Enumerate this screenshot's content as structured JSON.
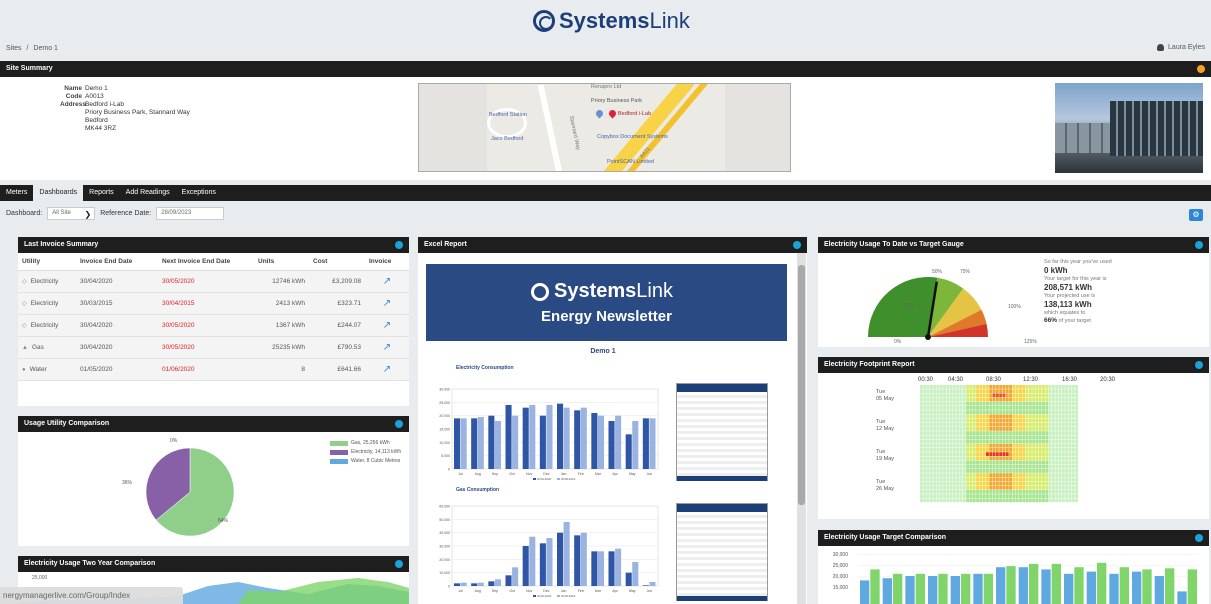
{
  "brand": {
    "name_bold": "Systems",
    "name_light": "Link"
  },
  "breadcrumb": {
    "root": "Sites",
    "sep": "/",
    "current": "Demo 1"
  },
  "user": {
    "name": "Laura Eyles"
  },
  "site_summary": {
    "title": "Site Summary",
    "name_label": "Name",
    "name": "Demo 1",
    "code_label": "Code",
    "code": "A0013",
    "address_label": "Address",
    "address": [
      "Bedford i-Lab",
      "Priory Business Park, Stannard Way",
      "Bedford",
      "MK44 3RZ"
    ],
    "map_labels": [
      "Priory Business Park",
      "Bedford i-Lab",
      "Bedford Station",
      "Jaco Bedford",
      "Copybox Document Systems",
      "PointSCAN Limited",
      "Stannard Way",
      "A421"
    ]
  },
  "tabs": [
    "Meters",
    "Dashboards",
    "Reports",
    "Add Readings",
    "Exceptions"
  ],
  "active_tab": "Dashboards",
  "dashboard_bar": {
    "label": "Dashboard:",
    "value": "All Site",
    "ref_label": "Reference Date:",
    "ref_value": "28/09/2023"
  },
  "invoice": {
    "title": "Last Invoice Summary",
    "headers": [
      "Utility",
      "Invoice End Date",
      "Next Invoice End Date",
      "Units",
      "Cost",
      "Invoice"
    ],
    "rows": [
      {
        "icon": "bulb-icon",
        "utility": "Electricity",
        "end": "30/04/2020",
        "next": "30/05/2020",
        "units": "12746 kWh",
        "cost": "£3,209.08"
      },
      {
        "icon": "bulb-icon",
        "utility": "Electricity",
        "end": "30/03/2015",
        "next": "30/04/2015",
        "units": "2413 kWh",
        "cost": "£323.71"
      },
      {
        "icon": "bulb-icon",
        "utility": "Electricity",
        "end": "30/04/2020",
        "next": "30/05/2020",
        "units": "1367 kWh",
        "cost": "£244.07"
      },
      {
        "icon": "flame-icon",
        "utility": "Gas",
        "end": "30/04/2020",
        "next": "30/05/2020",
        "units": "25235 kWh",
        "cost": "£790.53"
      },
      {
        "icon": "drop-icon",
        "utility": "Water",
        "end": "01/05/2020",
        "next": "01/06/2020",
        "units": "8",
        "cost": "£641.66"
      }
    ]
  },
  "usage_comparison": {
    "title": "Usage Utility Comparison",
    "chart_data": {
      "type": "pie",
      "slices": [
        {
          "name": "Gas, 25,256 kWh",
          "value": 64,
          "color": "#8fcf8a"
        },
        {
          "name": "Electricity, 14,113 kWh",
          "value": 36,
          "color": "#8760a8"
        },
        {
          "name": "Water, 8 Cubic Metres",
          "value": 0,
          "color": "#5fa8e0"
        }
      ],
      "labels": [
        "0%",
        "36%",
        "64%"
      ]
    }
  },
  "two_year": {
    "title": "Electricity Usage Two Year Comparison",
    "y_top": "25,000"
  },
  "excel_report": {
    "title": "Excel Report",
    "newsletter_title": "Energy Newsletter",
    "site": "Demo 1",
    "elec_chart_title": "Electricity Consumption",
    "gas_chart_title": "Gas Consumption",
    "elec_chart": {
      "type": "bar",
      "categories": [
        "Jul",
        "Aug",
        "Sep",
        "Oct",
        "Nov",
        "Dec",
        "Jan",
        "Feb",
        "Mar",
        "Apr",
        "May",
        "Jun"
      ],
      "ylim": [
        0,
        30000
      ],
      "yticks": [
        "30,000",
        "25,000",
        "20,000",
        "15,000",
        "10,000",
        "5,000",
        "0"
      ],
      "series": [
        {
          "name": "2019-2020",
          "values": [
            19000,
            19000,
            20000,
            24000,
            23000,
            20000,
            24500,
            22000,
            21000,
            18000,
            13000,
            19000
          ]
        },
        {
          "name": "2018-2019",
          "values": [
            19000,
            19500,
            18000,
            20000,
            24000,
            24000,
            23000,
            23000,
            20000,
            20000,
            18000,
            19000
          ]
        }
      ]
    },
    "gas_chart": {
      "type": "bar",
      "categories": [
        "Jul",
        "Aug",
        "Sep",
        "Oct",
        "Nov",
        "Dec",
        "Jan",
        "Feb",
        "Mar",
        "Apr",
        "May",
        "Jun"
      ],
      "ylim": [
        0,
        60000
      ],
      "yticks": [
        "60,000",
        "50,000",
        "40,000",
        "30,000",
        "20,000",
        "10,000",
        "0"
      ],
      "series": [
        {
          "name": "2019-2020",
          "values": [
            2000,
            2000,
            3500,
            8000,
            30000,
            32000,
            40000,
            38000,
            26000,
            26000,
            10000,
            500
          ]
        },
        {
          "name": "2018-2019",
          "values": [
            2500,
            2500,
            5000,
            14000,
            37000,
            36000,
            48000,
            40000,
            26000,
            28000,
            18000,
            3000
          ]
        }
      ]
    }
  },
  "gauge": {
    "title": "Electricity Usage To Date vs Target Gauge",
    "ticks": [
      "0%",
      "25%",
      "50%",
      "75%",
      "100%",
      "125%"
    ],
    "line1": "So far this year you've used",
    "used": "0 kWh",
    "line2": "Your target for this year is",
    "target": "208,571 kWh",
    "line3": "Your projected use is",
    "projected": "138,113 kWh",
    "line4": "which equates to",
    "pct": "66%",
    "line5": "of your target",
    "value_pct": 66
  },
  "footprint": {
    "title": "Electricity Footprint Report",
    "times": [
      "00:30",
      "04:30",
      "08:30",
      "12:30",
      "16:30",
      "20:30"
    ],
    "days": [
      "Tue 05 May",
      "Tue 12 May",
      "Tue 19 May",
      "Tue 26 May"
    ]
  },
  "target_comparison": {
    "title": "Electricity Usage Target Comparison",
    "yticks": [
      "30,000",
      "25,000",
      "20,000",
      "15,000"
    ],
    "chart_data": {
      "type": "bar",
      "series": [
        {
          "name": "actual",
          "values": [
            18000,
            19000,
            20000,
            20000,
            20000,
            21000,
            24000,
            24000,
            23000,
            21000,
            22000,
            21000,
            22000,
            20000,
            13000
          ]
        },
        {
          "name": "target",
          "values": [
            23000,
            21000,
            21000,
            21000,
            21000,
            21000,
            24500,
            25500,
            25500,
            24000,
            26000,
            24000,
            23000,
            23500,
            23000
          ]
        }
      ]
    }
  },
  "status_url": "nergymanagerlive.com/Group/Index"
}
